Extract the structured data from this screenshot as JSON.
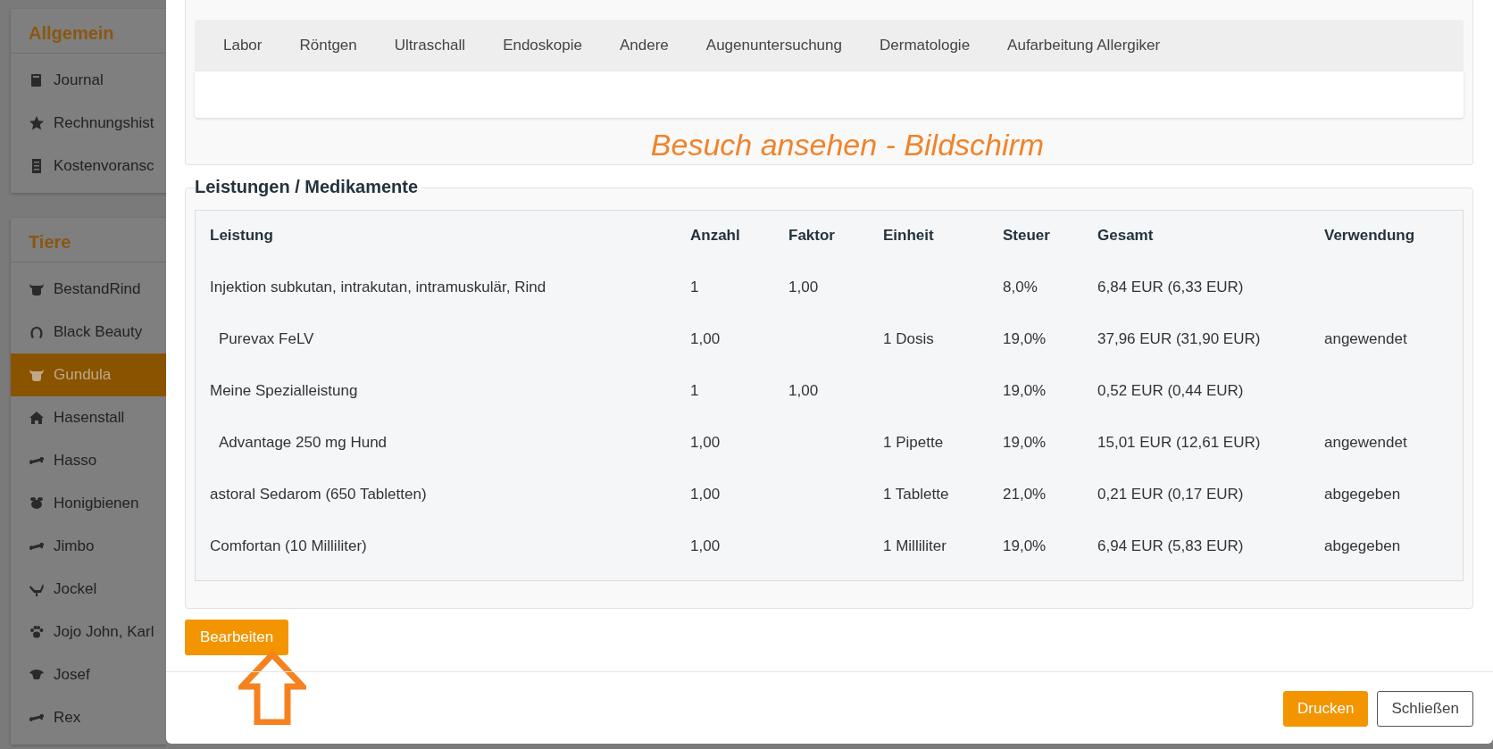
{
  "sidebar": {
    "sections": [
      {
        "title": "Allgemein",
        "items": [
          {
            "label": "Journal",
            "kind": "book",
            "selected": false
          },
          {
            "label": "Rechnungshist",
            "kind": "star",
            "selected": false
          },
          {
            "label": "Kostenvoransc",
            "kind": "list",
            "selected": false
          }
        ]
      },
      {
        "title": "Tiere",
        "items": [
          {
            "label": "BestandRind",
            "kind": "cow",
            "selected": false
          },
          {
            "label": "Black Beauty",
            "kind": "horseshoe",
            "selected": false
          },
          {
            "label": "Gundula",
            "kind": "cow",
            "selected": true
          },
          {
            "label": "Hasenstall",
            "kind": "house",
            "selected": false
          },
          {
            "label": "Hasso",
            "kind": "bone",
            "selected": false
          },
          {
            "label": "Honigbienen",
            "kind": "bee",
            "selected": false
          },
          {
            "label": "Jimbo",
            "kind": "bone",
            "selected": false
          },
          {
            "label": "Jockel",
            "kind": "bird",
            "selected": false
          },
          {
            "label": "Jojo John, Karl",
            "kind": "paw",
            "selected": false
          },
          {
            "label": "Josef",
            "kind": "sheep",
            "selected": false
          },
          {
            "label": "Rex",
            "kind": "bone",
            "selected": false
          }
        ]
      }
    ]
  },
  "modal": {
    "tabs": [
      {
        "label": "Labor",
        "selected": false
      },
      {
        "label": "Röntgen",
        "selected": false
      },
      {
        "label": "Ultraschall",
        "selected": false
      },
      {
        "label": "Endoskopie",
        "selected": false
      },
      {
        "label": "Andere",
        "selected": false
      },
      {
        "label": "Augenuntersuchung",
        "selected": false
      },
      {
        "label": "Dermatologie",
        "selected": false
      },
      {
        "label": "Aufarbeitung Allergiker",
        "selected": false
      }
    ],
    "annotation": "Besuch ansehen - Bildschirm",
    "services": {
      "title": "Leistungen / Medikamente",
      "columns": [
        "Leistung",
        "Anzahl",
        "Faktor",
        "Einheit",
        "Steuer",
        "Gesamt",
        "Verwendung"
      ],
      "rows": [
        {
          "cells": [
            "Injektion subkutan, intrakutan, intramuskulär, Rind",
            "1",
            "1,00",
            "",
            "8,0%",
            "6,84 EUR (6,33 EUR)",
            ""
          ],
          "children": [
            {
              "cells": [
                "Purevax FeLV",
                "1,00",
                "",
                "1 Dosis",
                "19,0%",
                "37,96 EUR (31,90 EUR)",
                "angewendet"
              ]
            }
          ]
        },
        {
          "cells": [
            "Meine Spezialleistung",
            "1",
            "1,00",
            "",
            "19,0%",
            "0,52 EUR (0,44 EUR)",
            ""
          ],
          "children": [
            {
              "cells": [
                "Advantage 250 mg Hund",
                "1,00",
                "",
                "1 Pipette",
                "19,0%",
                "15,01 EUR (12,61 EUR)",
                "angewendet"
              ]
            }
          ]
        },
        {
          "cells": [
            "astoral Sedarom (650 Tabletten)",
            "1,00",
            "",
            "1 Tablette",
            "21,0%",
            "0,21 EUR (0,17 EUR)",
            "abgegeben"
          ]
        },
        {
          "cells": [
            "Comfortan (10 Milliliter)",
            "1,00",
            "",
            "1 Milliliter",
            "19,0%",
            "6,94 EUR (5,83 EUR)",
            "abgegeben"
          ]
        }
      ]
    },
    "edit_button": "Bearbeiten",
    "footer_buttons": [
      {
        "label": "Drucken",
        "kind": "primary"
      },
      {
        "label": "Schließen",
        "kind": "secondary"
      }
    ]
  }
}
